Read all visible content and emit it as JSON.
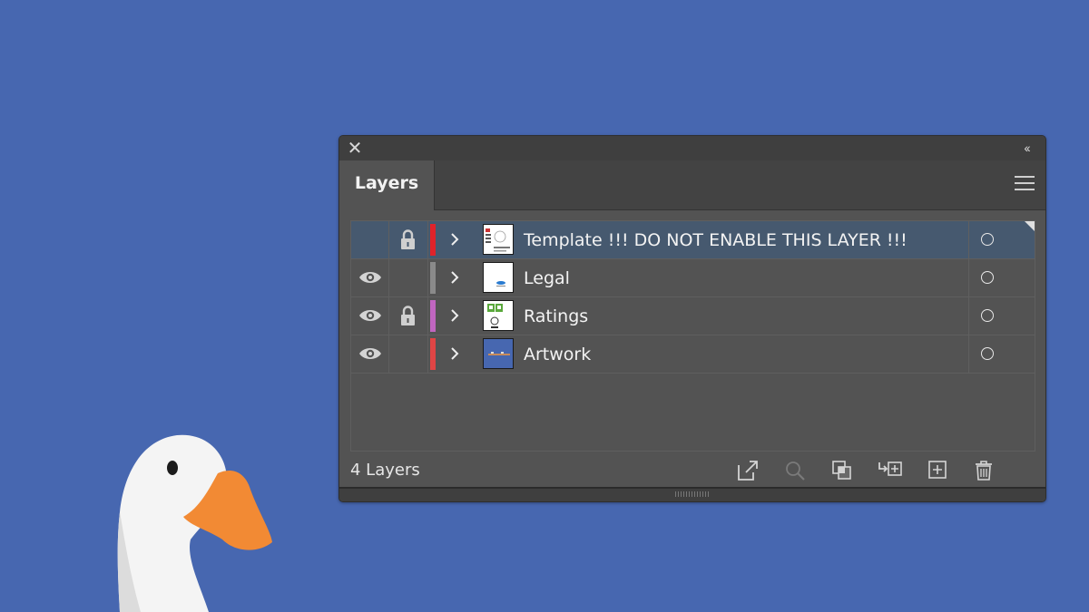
{
  "panel": {
    "title_tab": "Layers",
    "close_glyph": "✕",
    "collapse_glyph": "‹‹"
  },
  "layers": [
    {
      "name": "Template !!! DO NOT ENABLE THIS LAYER !!!",
      "visible": false,
      "locked": true,
      "color": "#e0232a",
      "selected": true
    },
    {
      "name": "Legal",
      "visible": true,
      "locked": false,
      "color": "#8a8a8a",
      "selected": false
    },
    {
      "name": "Ratings",
      "visible": true,
      "locked": true,
      "color": "#c066c0",
      "selected": false
    },
    {
      "name": "Artwork",
      "visible": true,
      "locked": false,
      "color": "#e04545",
      "selected": false
    }
  ],
  "footer": {
    "layer_count": "4 Layers",
    "icons": [
      "export-icon",
      "search-icon",
      "make-clipping-mask-icon",
      "create-sublayer-icon",
      "new-layer-icon",
      "delete-icon"
    ]
  },
  "colors": {
    "background": "#4767b0",
    "panel": "#535353",
    "selection": "#46596f",
    "goose_beak": "#f28a34"
  }
}
